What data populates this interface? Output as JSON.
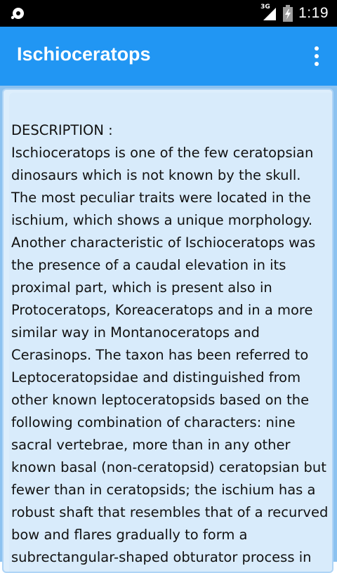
{
  "status_bar": {
    "network_label": "3G",
    "time": "1:19",
    "icons": [
      "sync-icon",
      "signal-icon",
      "battery-charging-icon"
    ]
  },
  "app_bar": {
    "title": "Ischioceratops",
    "overflow_icon": "more-vert-icon"
  },
  "content": {
    "description_label": "DESCRIPTION :",
    "description_text": " Ischioceratops is one of the few ceratopsian dinosaurs which is not known by the skull. The most peculiar traits were located in the ischium, which shows a unique morphology. Another characteristic of Ischioceratops was the presence of a caudal elevation in its proximal part, which is present also in Protoceratops, Koreaceratops and in a more similar way in Montanoceratops and Cerasinops. The taxon has been referred to Leptoceratopsidae and distinguished from other known leptoceratopsids based on the following combination of characters: nine sacral vertebrae, more than in any other known basal (non-ceratopsid) ceratopsian but fewer than in ceratopsids; the ischium has a robust shaft that resembles that of a recurved bow and flares gradually to form a subrectangular-shaped obturator process in"
  },
  "colors": {
    "app_bar": "#2196F3",
    "status_bar": "#000000",
    "content_background": "#8cc2f0",
    "card_background": "#ddeefc"
  }
}
